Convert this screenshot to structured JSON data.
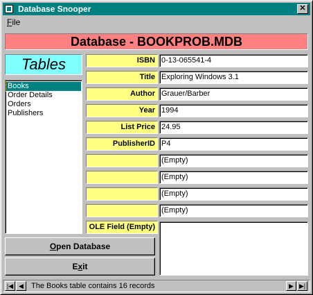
{
  "window": {
    "title": "Database Snooper",
    "close_glyph": "✕"
  },
  "menu": {
    "file_label": "File"
  },
  "banner": {
    "text": "Database - BOOKPROB.MDB"
  },
  "tables": {
    "label": "Tables",
    "items": [
      "Books",
      "Order Details",
      "Orders",
      "Publishers"
    ],
    "selected": "Books"
  },
  "fields": [
    {
      "label": "ISBN",
      "value": "0-13-065541-4"
    },
    {
      "label": "Title",
      "value": "Exploring Windows 3.1"
    },
    {
      "label": "Author",
      "value": "Grauer/Barber"
    },
    {
      "label": "Year",
      "value": "1994"
    },
    {
      "label": "List Price",
      "value": "24.95"
    },
    {
      "label": "PublisherID",
      "value": "P4"
    },
    {
      "label": "",
      "value": "(Empty)"
    },
    {
      "label": "",
      "value": "(Empty)"
    },
    {
      "label": "",
      "value": "(Empty)"
    },
    {
      "label": "",
      "value": "(Empty)"
    }
  ],
  "ole": {
    "label": "OLE Field (Empty)"
  },
  "buttons": {
    "open_label": "Open Database",
    "exit_label": "Exit"
  },
  "status": {
    "text": "The Books table contains 16 records",
    "first_icon": "first-record-icon",
    "prev_icon": "prev-record-icon",
    "next_icon": "next-record-icon",
    "last_icon": "last-record-icon"
  },
  "colors": {
    "titlebar": "#008080",
    "banner": "#ff8080",
    "tables_label": "#80ffff",
    "field_label": "#ffff80",
    "window": "#c0c0c0"
  }
}
